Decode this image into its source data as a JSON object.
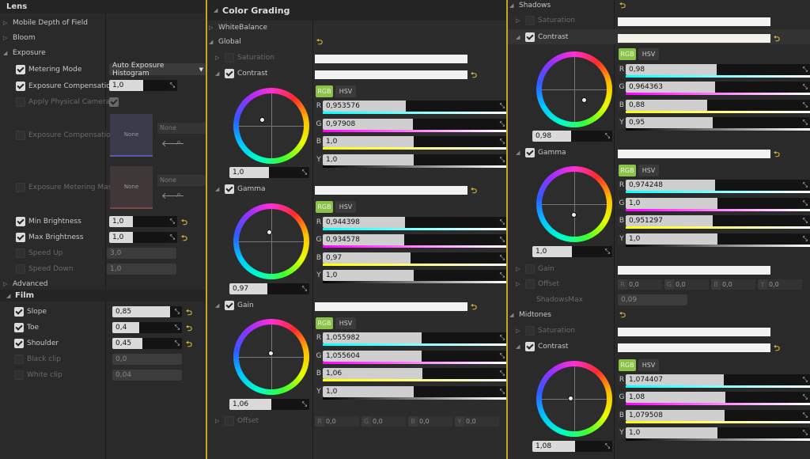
{
  "colors": {
    "accent": "#d2b93e",
    "rgb_tab": "#8bc34a"
  },
  "left": {
    "lens": "Lens",
    "mobile_dof": "Mobile Depth of Field",
    "bloom": "Bloom",
    "exposure": "Exposure",
    "metering_mode": "Metering Mode",
    "metering_value": "Auto Exposure Histogram",
    "exposure_comp": "Exposure Compensation",
    "exposure_comp_value": "1,0",
    "apply_phys": "Apply Physical Camera",
    "exposure_comp_curve": "Exposure Compensation",
    "none1": "None",
    "none1_thumb": "None",
    "exposure_metering_mask": "Exposure Metering Mas",
    "none2": "None",
    "none2_thumb": "None",
    "min_brightness": "Min Brightness",
    "min_brightness_value": "1,0",
    "max_brightness": "Max Brightness",
    "max_brightness_value": "1,0",
    "speed_up": "Speed Up",
    "speed_up_value": "3,0",
    "speed_down": "Speed Down",
    "speed_down_value": "1,0",
    "advanced": "Advanced",
    "film": "Film",
    "slope": "Slope",
    "slope_value": "0,85",
    "toe": "Toe",
    "toe_value": "0,4",
    "shoulder": "Shoulder",
    "shoulder_value": "0,45",
    "black_clip": "Black clip",
    "black_clip_value": "0,0",
    "white_clip": "White clip",
    "white_clip_value": "0,04"
  },
  "middle": {
    "title": "Color Grading",
    "white_balance": "WhiteBalance",
    "global": "Global",
    "saturation": "Saturation",
    "contrast": "Contrast",
    "contrast_wheel": "1,0",
    "contrast_rgb": "RGB",
    "contrast_hsv": "HSV",
    "contrast_r": "0,953576",
    "contrast_g": "0,97908",
    "contrast_b": "1,0",
    "contrast_y": "1,0",
    "gamma": "Gamma",
    "gamma_wheel": "0,97",
    "gamma_rgb": "RGB",
    "gamma_hsv": "HSV",
    "gamma_r": "0,944398",
    "gamma_g": "0,934578",
    "gamma_b": "0,97",
    "gamma_y": "1,0",
    "gain": "Gain",
    "gain_wheel": "1,06",
    "gain_rgb": "RGB",
    "gain_hsv": "HSV",
    "gain_r": "1,055982",
    "gain_g": "1,055604",
    "gain_b": "1,06",
    "gain_y": "1,0",
    "offset": "Offset",
    "offset_r": "0,0",
    "offset_g": "0,0",
    "offset_b": "0,0",
    "offset_y": "0,0"
  },
  "right": {
    "shadows": "Shadows",
    "saturation": "Saturation",
    "contrast": "Contrast",
    "contrast_wheel": "0,98",
    "contrast_rgb": "RGB",
    "contrast_hsv": "HSV",
    "contrast_r": "0,98",
    "contrast_g": "0,964363",
    "contrast_b": "0,88",
    "contrast_y": "0,95",
    "gamma": "Gamma",
    "gamma_wheel": "1,0",
    "gamma_rgb": "RGB",
    "gamma_hsv": "HSV",
    "gamma_r": "0,974248",
    "gamma_g": "1,0",
    "gamma_b": "0,951297",
    "gamma_y": "1,0",
    "gain": "Gain",
    "offset": "Offset",
    "offset_r": "0,0",
    "offset_g": "0,0",
    "offset_b": "0,0",
    "offset_y": "0,0",
    "shadows_max": "ShadowsMax",
    "shadows_max_value": "0,09",
    "midtones": "Midtones",
    "mid_saturation": "Saturation",
    "mid_contrast": "Contrast",
    "mid_contrast_wheel": "1,08",
    "mid_rgb": "RGB",
    "mid_hsv": "HSV",
    "mid_r": "1,074407",
    "mid_g": "1,08",
    "mid_b": "1,079508",
    "mid_y": "1,0"
  }
}
